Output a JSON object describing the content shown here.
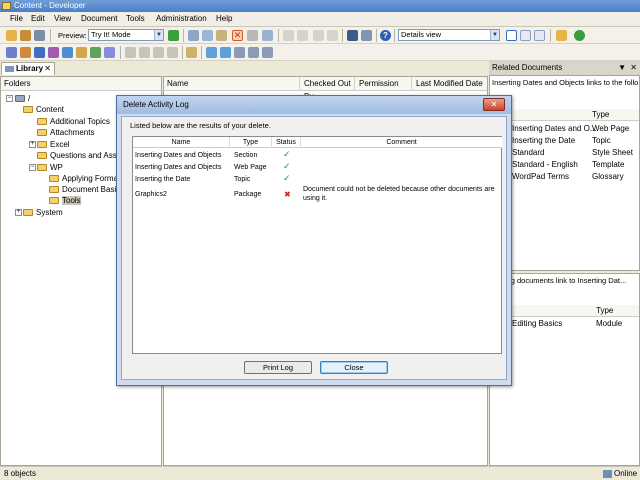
{
  "window": {
    "title": "Content - Developer"
  },
  "menu": [
    "File",
    "Edit",
    "View",
    "Document",
    "Tools",
    "Administration",
    "Help"
  ],
  "toolbar": {
    "preview_label": "Preview:",
    "preview_mode": "Try It! Mode",
    "view_mode": "Details view"
  },
  "library": {
    "tab_label": "Library",
    "tab_close": "✕",
    "folders_header": "Folders",
    "tree": {
      "root": "/",
      "content": "Content",
      "additional_topics": "Additional Topics",
      "attachments": "Attachments",
      "excel": "Excel",
      "questions": "Questions and Assessm",
      "wp": "WP",
      "applying": "Applying Formattin",
      "document_basics": "Document Basics",
      "tools": "Tools",
      "system": "System"
    }
  },
  "main_list": {
    "columns": [
      "Name",
      "Checked Out By",
      "Permission",
      "Last Modified Date"
    ]
  },
  "related": {
    "title": "Related Documents",
    "close": "✕",
    "pin": "▼",
    "top_caption": "Inserting Dates and Objects links to the follo...",
    "top_columns": [
      "",
      "Type"
    ],
    "top_rows": [
      {
        "name": "Inserting Dates and O...",
        "type": "Web Page"
      },
      {
        "name": "Inserting the Date",
        "type": "Topic"
      },
      {
        "name": "Standard",
        "type": "Style Sheet"
      },
      {
        "name": "Standard - English",
        "type": "Template"
      },
      {
        "name": "WordPad Terms",
        "type": "Glossary"
      }
    ],
    "bottom_caption": "llowing documents link to Inserting Dat...",
    "bottom_columns": [
      "",
      "Type"
    ],
    "bottom_rows": [
      {
        "name": "Editing Basics",
        "type": "Module"
      }
    ]
  },
  "status": {
    "objects": "8 objects",
    "online": "Online"
  },
  "dialog": {
    "title": "Delete Activity Log",
    "close": "✕",
    "intro": "Listed below are the results of your delete.",
    "columns": [
      "Name",
      "Type",
      "Status",
      "Comment"
    ],
    "rows": [
      {
        "name": "Inserting Dates and Objects",
        "type": "Section",
        "status": "✓",
        "comment": ""
      },
      {
        "name": "Inserting Dates and Objects",
        "type": "Web Page",
        "status": "✓",
        "comment": ""
      },
      {
        "name": "Inserting the Date",
        "type": "Topic",
        "status": "✓",
        "comment": ""
      },
      {
        "name": "Graphics2",
        "type": "Package",
        "status": "✖",
        "comment": "Document could not be deleted because other documents are using it."
      }
    ],
    "print_label": "Print Log",
    "close_label": "Close"
  }
}
